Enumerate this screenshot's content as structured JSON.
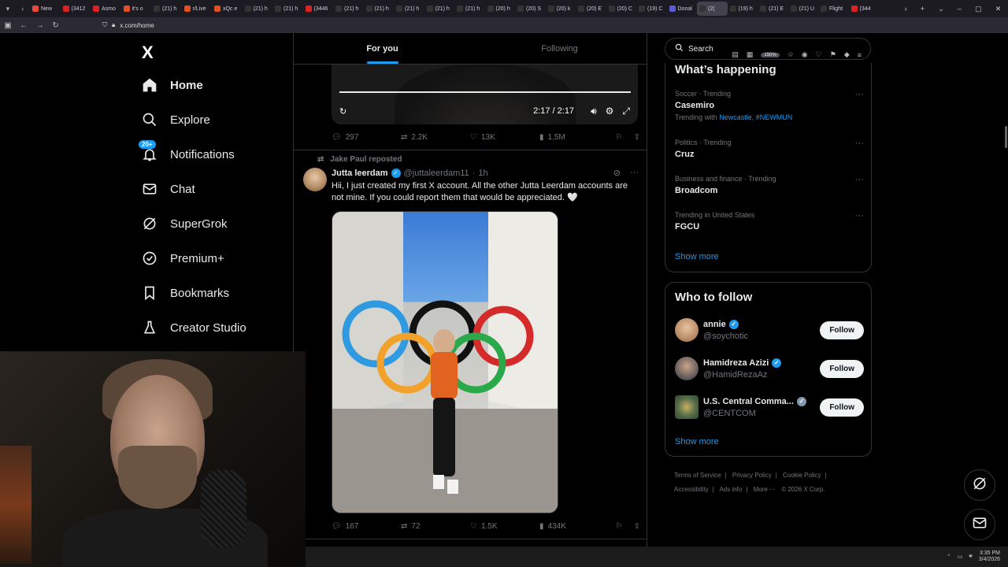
{
  "browser": {
    "tabs": [
      {
        "label": "New",
        "color": "#e84a3a"
      },
      {
        "label": "(3412",
        "color": "#e02020"
      },
      {
        "label": "Asmo",
        "color": "#e02020"
      },
      {
        "label": "it's o",
        "color": "#e05020"
      },
      {
        "label": "(21) h",
        "color": "#333"
      },
      {
        "label": "r/Live",
        "color": "#e05020"
      },
      {
        "label": "xQc e",
        "color": "#e05020"
      },
      {
        "label": "(21) h",
        "color": "#333"
      },
      {
        "label": "(21) h",
        "color": "#333"
      },
      {
        "label": "(3446",
        "color": "#e02020"
      },
      {
        "label": "(21) h",
        "color": "#333"
      },
      {
        "label": "(21) h",
        "color": "#333"
      },
      {
        "label": "(21) h",
        "color": "#333"
      },
      {
        "label": "(21) h",
        "color": "#333"
      },
      {
        "label": "(21) h",
        "color": "#333"
      },
      {
        "label": "(20) h",
        "color": "#333"
      },
      {
        "label": "(20) S",
        "color": "#333"
      },
      {
        "label": "(20) k",
        "color": "#333"
      },
      {
        "label": "(20) E",
        "color": "#333"
      },
      {
        "label": "(20) C",
        "color": "#333"
      },
      {
        "label": "(19) C",
        "color": "#333"
      },
      {
        "label": "Donal",
        "color": "#5b5bd6"
      },
      {
        "label": "(2(",
        "color": "#333"
      },
      {
        "label": "(19) h",
        "color": "#333"
      },
      {
        "label": "(21) E",
        "color": "#333"
      },
      {
        "label": "(21) U",
        "color": "#333"
      },
      {
        "label": "Flight",
        "color": "#333"
      },
      {
        "label": "(344",
        "color": "#e02020"
      }
    ],
    "url": "x.com/home",
    "zoom": "150%"
  },
  "nav": {
    "logo": "X",
    "items": [
      {
        "label": "Home",
        "icon": "home-icon"
      },
      {
        "label": "Explore",
        "icon": "search-icon"
      },
      {
        "label": "Notifications",
        "icon": "bell-icon",
        "badge": "20+"
      },
      {
        "label": "Chat",
        "icon": "mail-icon"
      },
      {
        "label": "SuperGrok",
        "icon": "grok-icon"
      },
      {
        "label": "Premium+",
        "icon": "premium-icon"
      },
      {
        "label": "Bookmarks",
        "icon": "bookmark-icon"
      },
      {
        "label": "Creator Studio",
        "icon": "flask-icon"
      }
    ]
  },
  "timeline": {
    "tabs": [
      "For you",
      "Following"
    ],
    "video": {
      "time": "2:17 / 2:17"
    },
    "tweet1_stats": {
      "replies": "297",
      "reposts": "2.2K",
      "likes": "13K",
      "views": "1.5M"
    },
    "repost_by": "Jake Paul reposted",
    "tweet2": {
      "name": "Jutta leerdam",
      "handle": "@juttaleerdam11",
      "time": "1h",
      "text": "Hii, I just created my first X account. All the other Jutta Leerdam accounts are not mine. If you could report them that would be appreciated. 🤍",
      "stats": {
        "replies": "167",
        "reposts": "72",
        "likes": "1.5K",
        "views": "434K"
      }
    }
  },
  "sidebar": {
    "search_placeholder": "Search",
    "happening": {
      "title": "What’s happening",
      "trends": [
        {
          "meta": "Soccer · Trending",
          "topic": "Casemiro",
          "sub_prefix": "Trending with",
          "sub_links": "Newcastle, #NEWMUN"
        },
        {
          "meta": "Politics · Trending",
          "topic": "Cruz"
        },
        {
          "meta": "Business and finance · Trending",
          "topic": "Broadcom"
        },
        {
          "meta": "Trending in United States",
          "topic": "FGCU"
        }
      ],
      "show_more": "Show more"
    },
    "who_to_follow": {
      "title": "Who to follow",
      "accounts": [
        {
          "name": "annie",
          "handle": "@soychotic",
          "button": "Follow"
        },
        {
          "name": "Hamidreza Azizi",
          "handle": "@HamidRezaAz",
          "button": "Follow"
        },
        {
          "name": "U.S. Central Comma...",
          "handle": "@CENTCOM",
          "button": "Follow"
        }
      ],
      "show_more": "Show more"
    },
    "footer": [
      "Terms of Service",
      "|",
      "Privacy Policy",
      "|",
      "Cookie Policy",
      "|",
      "Accessibility",
      "|",
      "Ads info",
      "|",
      "More ···",
      "© 2026 X Corp."
    ]
  },
  "taskbar": {
    "time": "3:35 PM",
    "date": "3/4/2026"
  }
}
